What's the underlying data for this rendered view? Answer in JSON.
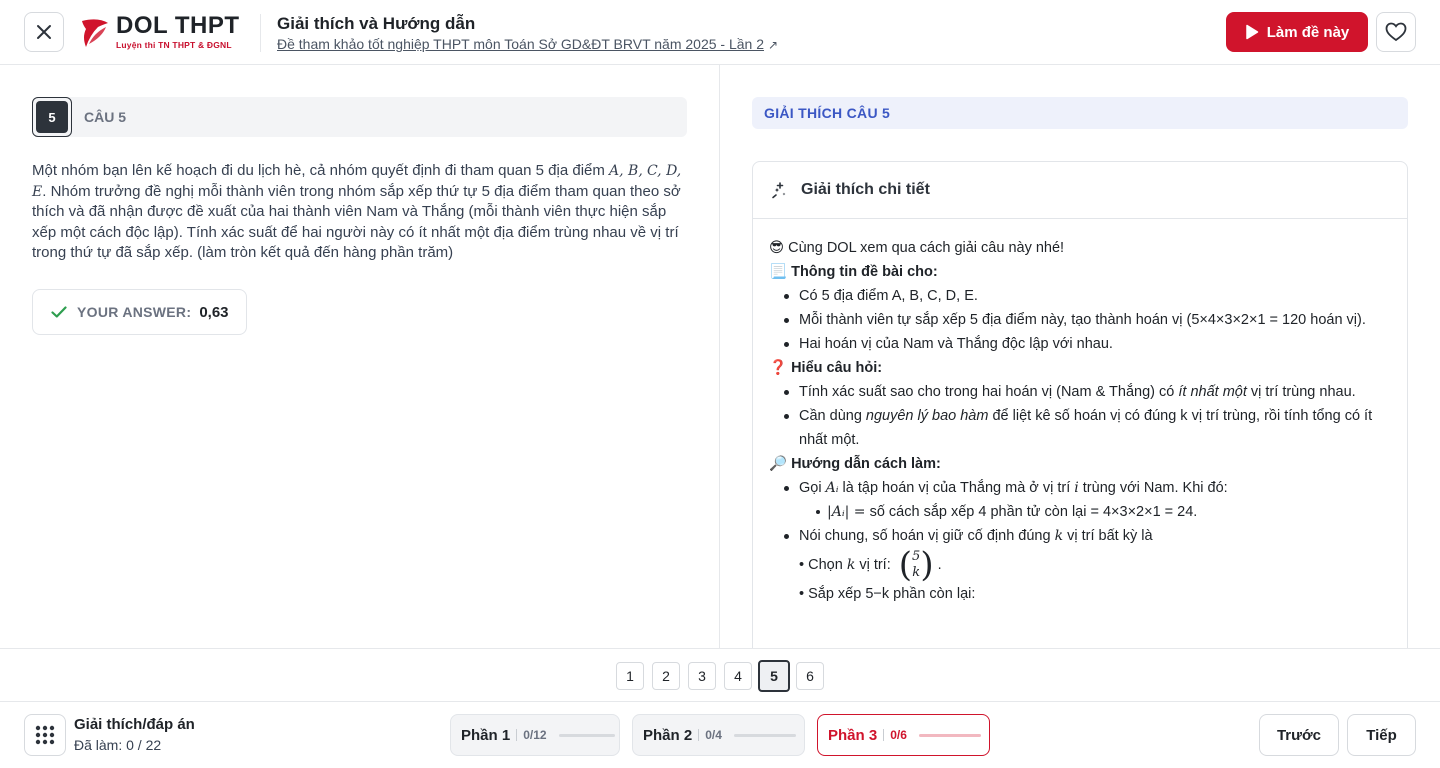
{
  "header": {
    "logo_title": "DOL THPT",
    "logo_sub": "Luyện thi TN THPT & ĐGNL",
    "title": "Giải thích và Hướng dẫn",
    "link_text": "Đề tham khảo tốt nghiệp THPT môn Toán Sở GD&ĐT BRVT năm 2025 - Lần 2",
    "link_arrow": "↗",
    "do_exam_label": "Làm đề này"
  },
  "question": {
    "number": "5",
    "label": "CÂU 5",
    "text_part1": "Một nhóm bạn lên kế hoạch đi du lịch hè, cả nhóm quyết định đi tham quan 5 địa điểm",
    "math_places_1": "A, B,",
    "math_places_2": "C, D, E",
    "text_part2": ". Nhóm trưởng đề nghị mỗi thành viên trong nhóm sắp xếp thứ tự 5 địa điểm tham quan theo sở thích và đã nhận được đề xuất của hai thành viên Nam và Thắng (mỗi thành viên thực hiện sắp xếp một cách độc lập). Tính xác suất để hai người này có ít nhất một địa điểm trùng nhau về vị trí trong thứ tự đã sắp xếp. (làm tròn kết quả đến hàng phần trăm)",
    "answer_label": "YOUR ANSWER:",
    "answer_value": "0,63"
  },
  "explanation": {
    "bar_title": "GIẢI THÍCH CÂU 5",
    "card_title": "Giải thích chi tiết",
    "intro": "😎 Cùng DOL xem qua cách giải câu này nhé!",
    "s1_title": "📃 Thông tin đề bài cho:",
    "s1_items": [
      "Có 5 địa điểm A, B, C, D, E.",
      "Mỗi thành viên tự sắp xếp 5 địa điểm này, tạo thành hoán vị (5×4×3×2×1 = 120 hoán vị).",
      "Hai hoán vị của Nam và Thắng độc lập với nhau."
    ],
    "s2_title": "❓ Hiểu câu hỏi:",
    "s2_item1_a": "Tính xác suất sao cho trong hai hoán vị (Nam & Thắng) có ",
    "s2_item1_em": "ít nhất một",
    "s2_item1_b": " vị trí trùng nhau.",
    "s2_item2_a": "Cần dùng ",
    "s2_item2_em": "nguyên lý bao hàm",
    "s2_item2_b": " để liệt kê số hoán vị có đúng k vị trí trùng, rồi tính tổng có ít nhất một.",
    "s3_title": "🔎 Hướng dẫn cách làm:",
    "s3_item1_a": "Gọi ",
    "s3_item1_math1": "Aᵢ",
    "s3_item1_b": " là tập hoán vị của Thắng mà ở vị trí ",
    "s3_item1_math2": "i",
    "s3_item1_c": " trùng với Nam. Khi đó:",
    "s3_sub1_math": "|Aᵢ| =",
    "s3_sub1_text": " số cách sắp xếp 4 phần tử còn lại = 4×3×2×1 = 24.",
    "s3_item2_a": "Nói chung, số hoán vị giữ cố định đúng ",
    "s3_item2_math": "k",
    "s3_item2_b": " vị trí bất kỳ là",
    "s3_choose_a": "• Chọn ",
    "s3_choose_math": "k",
    "s3_choose_b": " vị trí: ",
    "binom_top": "5",
    "binom_bottom": "k",
    "s3_choose_end": ".",
    "s3_arrange": "• Sắp xếp 5−k phần còn lại:"
  },
  "pager": {
    "pages": [
      "1",
      "2",
      "3",
      "4",
      "5",
      "6"
    ],
    "active": "5"
  },
  "footer": {
    "title": "Giải thích/đáp án",
    "progress": "Đã làm: 0 / 22",
    "parts": [
      {
        "name": "Phần 1",
        "count": "0/12"
      },
      {
        "name": "Phần 2",
        "count": "0/4"
      },
      {
        "name": "Phần 3",
        "count": "0/6"
      }
    ],
    "prev_label": "Trước",
    "next_label": "Tiếp"
  },
  "colors": {
    "brand_red": "#d0142c",
    "accent_blue": "#3b57c4",
    "dark": "#2d333b"
  },
  "icons": [
    "close-icon",
    "logo-icon",
    "external-link-icon",
    "play-icon",
    "heart-icon",
    "check-icon",
    "sparkle-icon",
    "grid-icon"
  ]
}
